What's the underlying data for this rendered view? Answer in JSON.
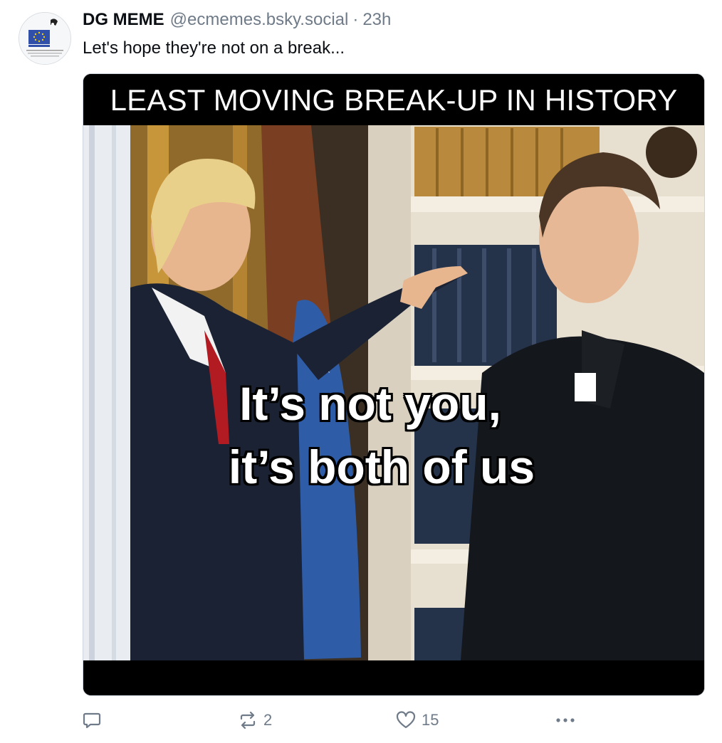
{
  "post": {
    "display_name": "DG MEME",
    "handle": "@ecmemes.bsky.social",
    "separator": "·",
    "time": "23h",
    "text": "Let's hope they're not on a break...",
    "avatar_icon": "eu-flag-logo-icon",
    "avatar_text": "DG MEME",
    "avatar_caption": "Directorate-General for Memes Satire and Saber EU",
    "image": {
      "banner": "LEAST MOVING BREAK-UP IN HISTORY",
      "caption_line1": "It’s not you,",
      "caption_line2": "it’s both of us"
    },
    "actions": {
      "reply_icon": "reply-bubble-icon",
      "repost_icon": "repost-icon",
      "repost_count": "2",
      "like_icon": "heart-icon",
      "like_count": "15",
      "more_icon": "more-options-icon"
    }
  }
}
